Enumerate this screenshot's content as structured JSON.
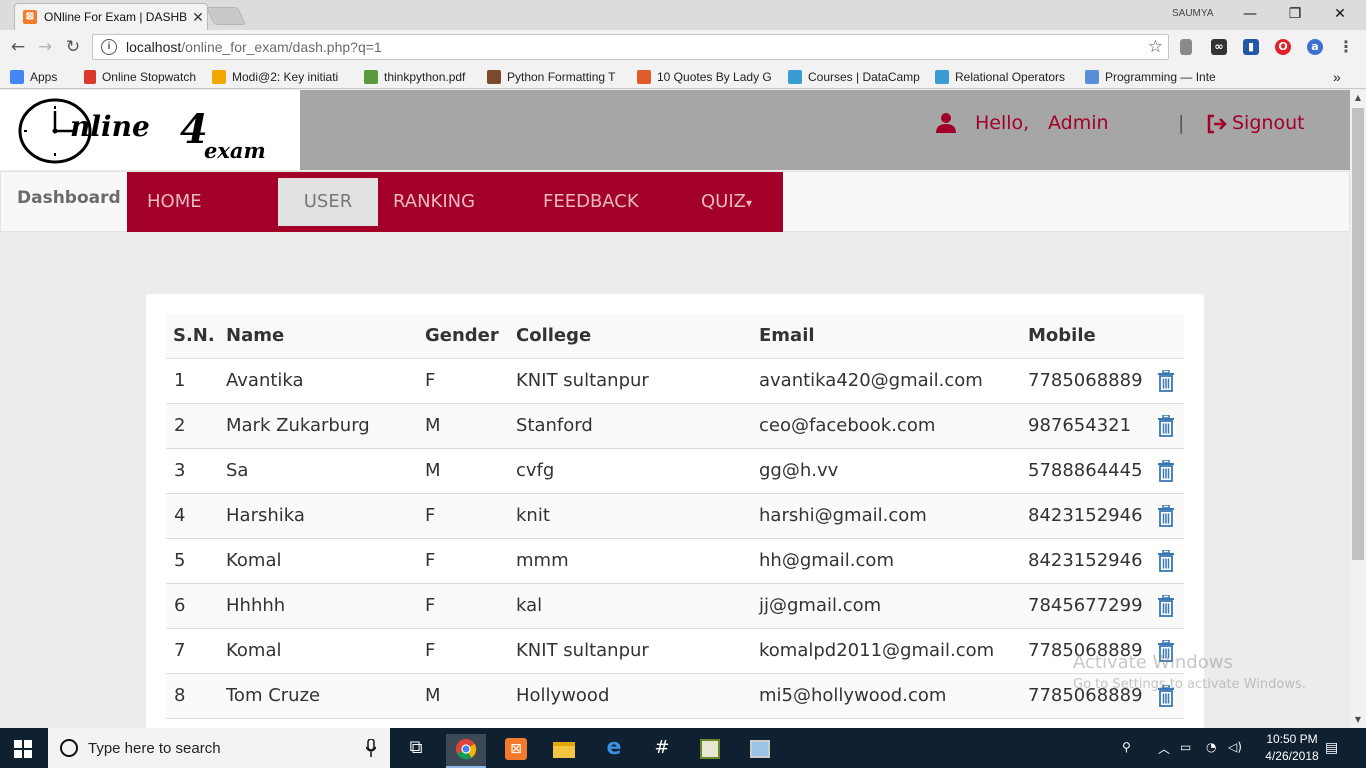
{
  "browser": {
    "tab_title": "ONline For Exam | DASHB",
    "tab_close": "✕",
    "profile": "SAUMYA",
    "window_controls": [
      "—",
      "❐",
      "✕"
    ],
    "url_host": "localhost",
    "url_path": "/online_for_exam/dash.php?q=1",
    "bookmarks": [
      {
        "label": "Apps",
        "icon": "apps-grid-icon",
        "color": "#4285f4"
      },
      {
        "label": "Online Stopwatch",
        "icon": "stopwatch-icon",
        "color": "#d9382b"
      },
      {
        "label": "Modi@2: Key initiati",
        "icon": "rainbow-icon",
        "color": "#f2a600"
      },
      {
        "label": "thinkpython.pdf",
        "icon": "sprout-icon",
        "color": "#5a9a3c"
      },
      {
        "label": "Python Formatting T",
        "icon": "python-icon",
        "color": "#7a4a2c"
      },
      {
        "label": "10 Quotes By Lady G",
        "icon": "s-icon",
        "color": "#e05a2a"
      },
      {
        "label": "Courses | DataCamp",
        "icon": "shield-icon",
        "color": "#3b9bd5"
      },
      {
        "label": "Relational Operators",
        "icon": "shield-icon",
        "color": "#3b9bd5"
      },
      {
        "label": "Programming — Inte",
        "icon": "ib-icon",
        "color": "#5a8ed6"
      }
    ],
    "bookmarks_more": "»"
  },
  "header": {
    "logo_online": "nline",
    "logo_four": "4",
    "logo_exam": "exam",
    "hello": "Hello,",
    "username": "Admin",
    "divider": "|",
    "signout": "Signout",
    "accent_color": "#a20028"
  },
  "nav": {
    "brand": "Dashboard",
    "items": [
      {
        "label": "HOME"
      },
      {
        "label": "USER"
      },
      {
        "label": "RANKING"
      },
      {
        "label": "FEEDBACK"
      },
      {
        "label": "QUIZ"
      }
    ],
    "active": "USER",
    "dropdown_caret": "▾"
  },
  "table": {
    "headers": [
      "S.N.",
      "Name",
      "Gender",
      "College",
      "Email",
      "Mobile"
    ],
    "rows": [
      {
        "sn": "1",
        "name": "Avantika",
        "gender": "F",
        "college": "KNIT sultanpur",
        "email": "avantika420@gmail.com",
        "mobile": "7785068889"
      },
      {
        "sn": "2",
        "name": "Mark Zukarburg",
        "gender": "M",
        "college": "Stanford",
        "email": "ceo@facebook.com",
        "mobile": "987654321"
      },
      {
        "sn": "3",
        "name": "Sa",
        "gender": "M",
        "college": "cvfg",
        "email": "gg@h.vv",
        "mobile": "5788864445"
      },
      {
        "sn": "4",
        "name": "Harshika",
        "gender": "F",
        "college": "knit",
        "email": "harshi@gmail.com",
        "mobile": "8423152946"
      },
      {
        "sn": "5",
        "name": "Komal",
        "gender": "F",
        "college": "mmm",
        "email": "hh@gmail.com",
        "mobile": "8423152946"
      },
      {
        "sn": "6",
        "name": "Hhhhh",
        "gender": "F",
        "college": "kal",
        "email": "jj@gmail.com",
        "mobile": "7845677299"
      },
      {
        "sn": "7",
        "name": "Komal",
        "gender": "F",
        "college": "KNIT sultanpur",
        "email": "komalpd2011@gmail.com",
        "mobile": "7785068889"
      },
      {
        "sn": "8",
        "name": "Tom Cruze",
        "gender": "M",
        "college": "Hollywood",
        "email": "mi5@hollywood.com",
        "mobile": "7785068889"
      }
    ],
    "delete_icon": "trash-icon",
    "delete_color": "#3a78b5"
  },
  "watermark": {
    "line1": "Activate Windows",
    "line2": "Go to Settings to activate Windows."
  },
  "taskbar": {
    "search_placeholder": "Type here to search",
    "time": "10:50 PM",
    "date": "4/26/2018"
  }
}
